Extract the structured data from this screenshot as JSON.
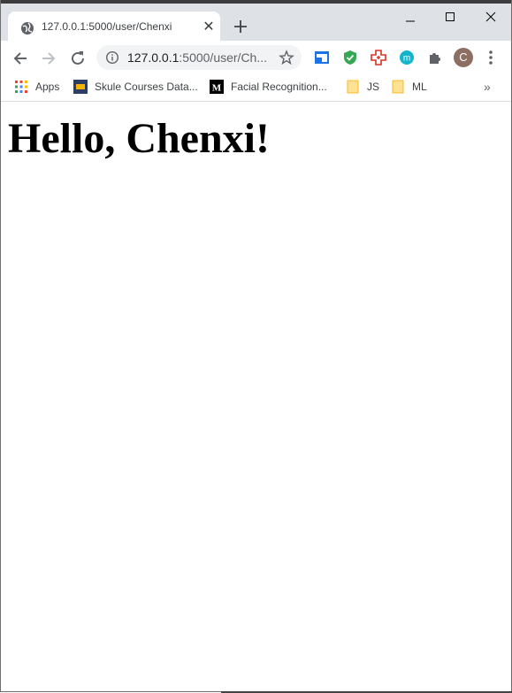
{
  "tab": {
    "title": "127.0.0.1:5000/user/Chenxi",
    "close_glyph": "✕"
  },
  "omnibox": {
    "url_host": "127.0.0.1",
    "url_rest": ":5000/user/Ch..."
  },
  "profile": {
    "initial": "C"
  },
  "bookmarks": {
    "apps": "Apps",
    "items": [
      "Skule Courses Data...",
      "Facial Recognition...",
      "JS",
      "ML"
    ],
    "more": "»"
  },
  "page": {
    "heading": "Hello, Chenxi!"
  },
  "colors": {
    "tab_strip": "#dee1e6",
    "omnibox_bg": "#f1f3f4",
    "icon_gray": "#5f6368"
  }
}
